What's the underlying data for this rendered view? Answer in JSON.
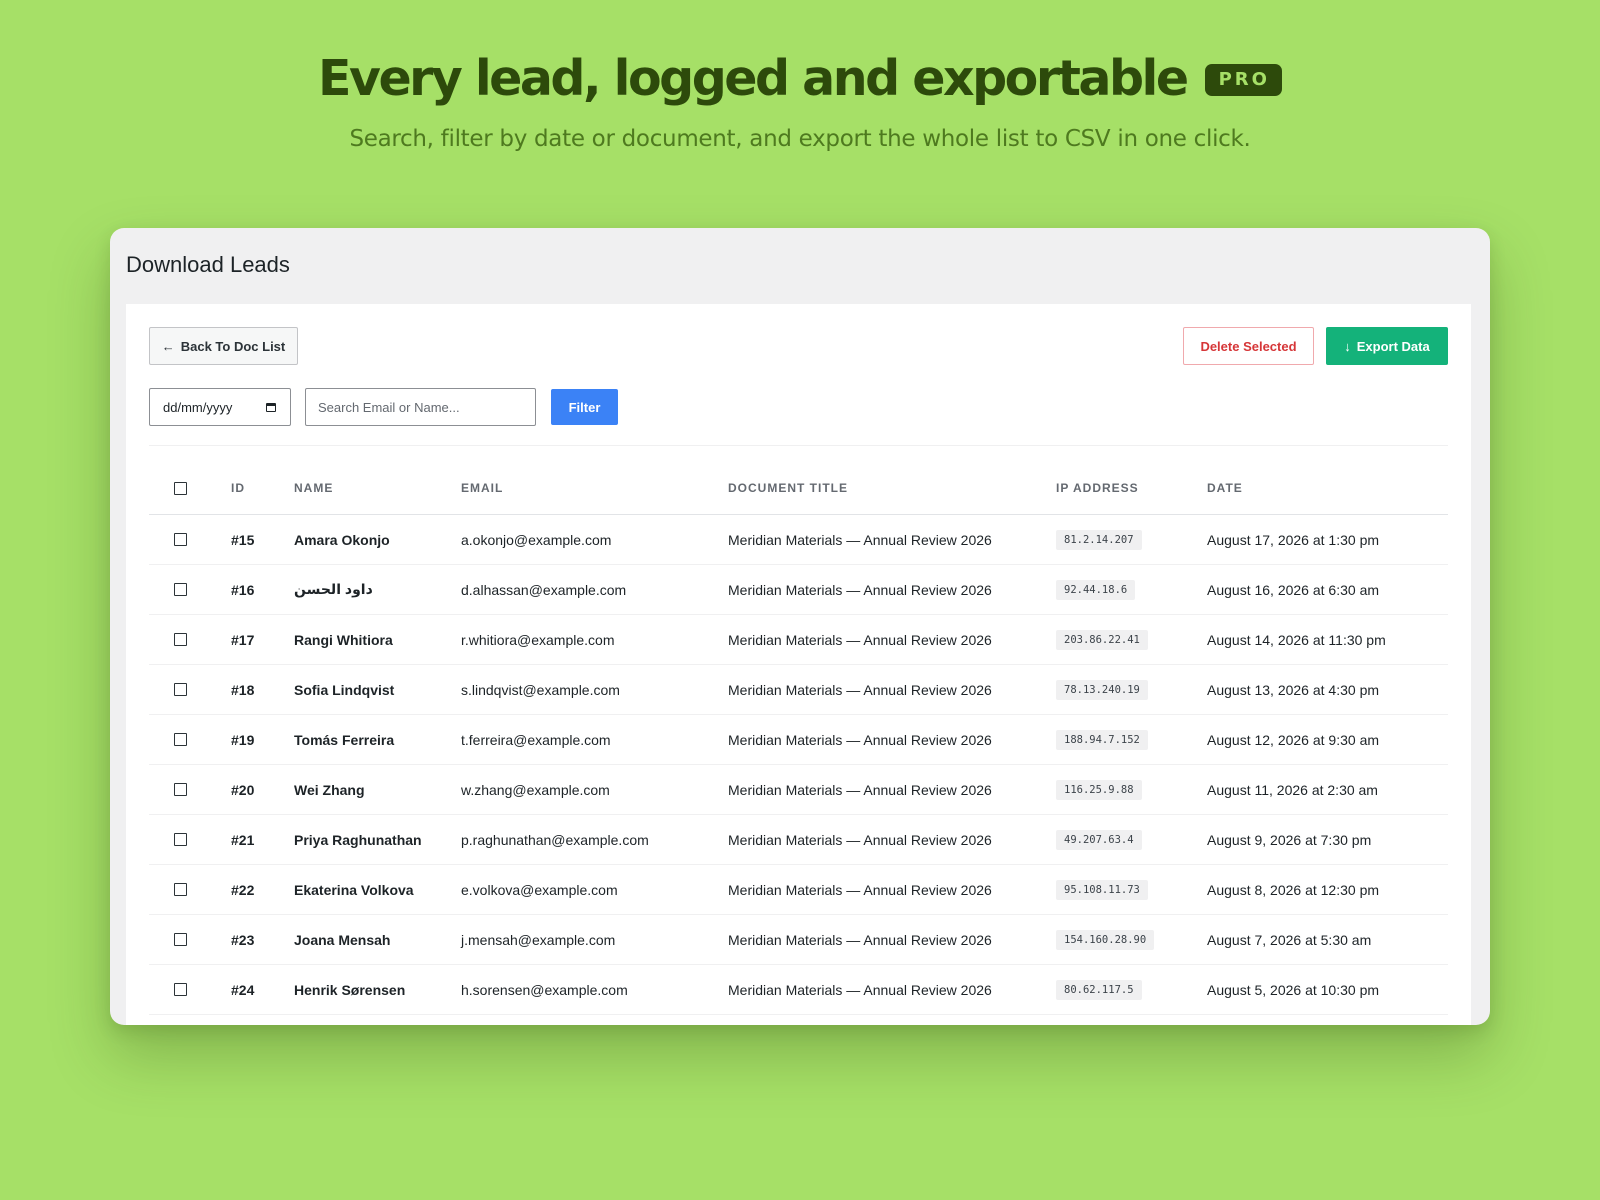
{
  "hero": {
    "title": "Every lead, logged and exportable",
    "badge": "PRO",
    "subtitle": "Search, filter by date or document, and export the whole list to CSV in one click."
  },
  "window": {
    "title": "Download Leads"
  },
  "toolbar": {
    "back_label": "Back To Doc List",
    "back_icon": "←",
    "delete_label": "Delete Selected",
    "export_label": "Export Data",
    "export_icon": "↓"
  },
  "filters": {
    "date_placeholder": "dd/mm/yyyy",
    "search_placeholder": "Search Email or Name...",
    "filter_label": "Filter"
  },
  "table": {
    "headers": [
      "ID",
      "NAME",
      "EMAIL",
      "DOCUMENT TITLE",
      "IP ADDRESS",
      "DATE"
    ],
    "rows": [
      {
        "id": "#15",
        "name": "Amara Okonjo",
        "email": "a.okonjo@example.com",
        "doc": "Meridian Materials — Annual Review 2026",
        "ip": "81.2.14.207",
        "date": "August 17, 2026 at 1:30 pm"
      },
      {
        "id": "#16",
        "name": "داود الحسن",
        "email": "d.alhassan@example.com",
        "doc": "Meridian Materials — Annual Review 2026",
        "ip": "92.44.18.6",
        "date": "August 16, 2026 at 6:30 am"
      },
      {
        "id": "#17",
        "name": "Rangi Whitiora",
        "email": "r.whitiora@example.com",
        "doc": "Meridian Materials — Annual Review 2026",
        "ip": "203.86.22.41",
        "date": "August 14, 2026 at 11:30 pm"
      },
      {
        "id": "#18",
        "name": "Sofia Lindqvist",
        "email": "s.lindqvist@example.com",
        "doc": "Meridian Materials — Annual Review 2026",
        "ip": "78.13.240.19",
        "date": "August 13, 2026 at 4:30 pm"
      },
      {
        "id": "#19",
        "name": "Tomás Ferreira",
        "email": "t.ferreira@example.com",
        "doc": "Meridian Materials — Annual Review 2026",
        "ip": "188.94.7.152",
        "date": "August 12, 2026 at 9:30 am"
      },
      {
        "id": "#20",
        "name": "Wei Zhang",
        "email": "w.zhang@example.com",
        "doc": "Meridian Materials — Annual Review 2026",
        "ip": "116.25.9.88",
        "date": "August 11, 2026 at 2:30 am"
      },
      {
        "id": "#21",
        "name": "Priya Raghunathan",
        "email": "p.raghunathan@example.com",
        "doc": "Meridian Materials — Annual Review 2026",
        "ip": "49.207.63.4",
        "date": "August 9, 2026 at 7:30 pm"
      },
      {
        "id": "#22",
        "name": "Ekaterina Volkova",
        "email": "e.volkova@example.com",
        "doc": "Meridian Materials — Annual Review 2026",
        "ip": "95.108.11.73",
        "date": "August 8, 2026 at 12:30 pm"
      },
      {
        "id": "#23",
        "name": "Joana Mensah",
        "email": "j.mensah@example.com",
        "doc": "Meridian Materials — Annual Review 2026",
        "ip": "154.160.28.90",
        "date": "August 7, 2026 at 5:30 am"
      },
      {
        "id": "#24",
        "name": "Henrik Sørensen",
        "email": "h.sorensen@example.com",
        "doc": "Meridian Materials — Annual Review 2026",
        "ip": "80.62.117.5",
        "date": "August 5, 2026 at 10:30 pm"
      }
    ]
  },
  "colors": {
    "background": "#a6e067",
    "headline": "#2d4a0b",
    "export_button": "#14b27a",
    "filter_button": "#3b82f6",
    "delete_text": "#d63638",
    "email_link": "#3b82f6"
  }
}
